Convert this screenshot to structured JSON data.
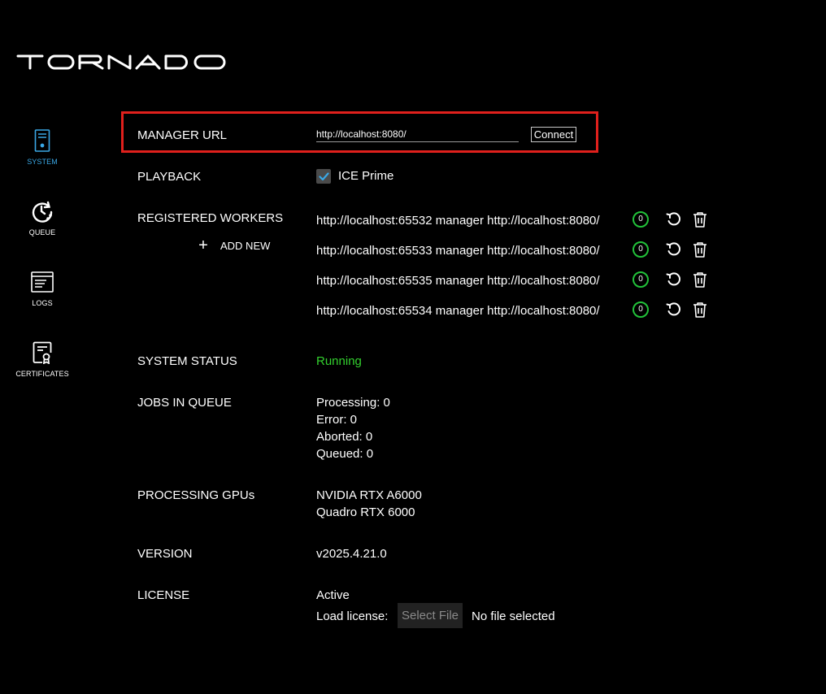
{
  "app": {
    "logo_text": "TORNADO"
  },
  "nav": {
    "items": [
      {
        "label": "SYSTEM",
        "icon": "server-icon",
        "active": true
      },
      {
        "label": "QUEUE",
        "icon": "clock-icon",
        "active": false
      },
      {
        "label": "LOGS",
        "icon": "log-icon",
        "active": false
      },
      {
        "label": "CERTIFICATES",
        "icon": "certificate-icon",
        "active": false
      }
    ]
  },
  "manager": {
    "label": "MANAGER URL",
    "url_value": "http://localhost:8080/",
    "connect_label": "Connect"
  },
  "playback": {
    "label": "PLAYBACK",
    "option_label": "ICE Prime",
    "checked": true
  },
  "workers": {
    "label": "REGISTERED WORKERS",
    "add_new_label": "ADD NEW",
    "items": [
      {
        "text": "http://localhost:65532 manager http://localhost:8080/",
        "count": "0"
      },
      {
        "text": "http://localhost:65533 manager http://localhost:8080/",
        "count": "0"
      },
      {
        "text": "http://localhost:65535 manager http://localhost:8080/",
        "count": "0"
      },
      {
        "text": "http://localhost:65534 manager http://localhost:8080/",
        "count": "0"
      }
    ]
  },
  "system_status": {
    "label": "SYSTEM STATUS",
    "value": "Running"
  },
  "jobs": {
    "label": "JOBS IN QUEUE",
    "lines": [
      "Processing: 0",
      "Error: 0",
      "Aborted: 0",
      "Queued: 0"
    ]
  },
  "gpus": {
    "label": "PROCESSING GPUs",
    "lines": [
      "NVIDIA RTX A6000",
      "Quadro RTX 6000"
    ]
  },
  "version": {
    "label": "VERSION",
    "value": "v2025.4.21.0"
  },
  "license": {
    "label": "LICENSE",
    "status": "Active",
    "load_label": "Load license:",
    "file_button": "Select File",
    "file_status": "No file selected"
  },
  "colors": {
    "accent": "#3aa8e6",
    "running": "#33d12e",
    "badge": "#22c23a",
    "highlight": "#e0201c"
  }
}
